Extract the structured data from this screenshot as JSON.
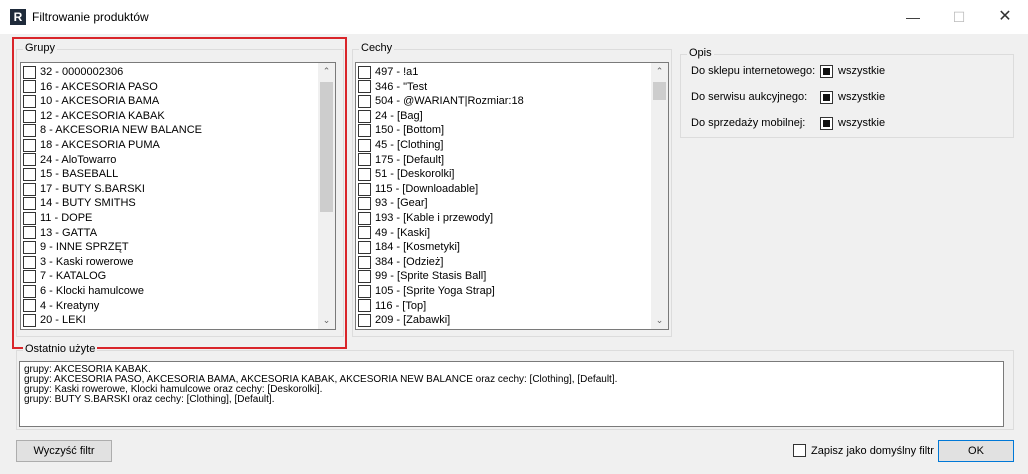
{
  "window": {
    "icon_letter": "R",
    "title": "Filtrowanie produktów",
    "minimize": "—",
    "maximize": "☐",
    "close": "✕"
  },
  "groups": {
    "label": "Grupy",
    "items": [
      "32 - 0000002306",
      "16 - AKCESORIA  PASO",
      "10 - AKCESORIA BAMA",
      "12 - AKCESORIA KABAK",
      "8 - AKCESORIA NEW BALANCE",
      "18 - AKCESORIA PUMA",
      "24 - AloTowarro",
      "15 - BASEBALL",
      "17 - BUTY S.BARSKI",
      "14 - BUTY SMITHS",
      "11 - DOPE",
      "13 - GATTA",
      "9 - INNE SPRZĘT",
      "3 - Kaski rowerowe",
      "7 - KATALOG",
      "6 - Klocki hamulcowe",
      "4 - Kreatyny",
      "20 - LEKI"
    ]
  },
  "features": {
    "label": "Cechy",
    "items": [
      "497 - !a1",
      "346 - \"Test",
      "504 - @WARIANT|Rozmiar:18",
      "24 - [Bag]",
      "150 - [Bottom]",
      "45 - [Clothing]",
      "175 - [Default]",
      "51 - [Deskorolki]",
      "115 - [Downloadable]",
      "93 - [Gear]",
      "193 - [Kable i przewody]",
      "49 - [Kaski]",
      "184 - [Kosmetyki]",
      "384 - [Odzież]",
      "99 - [Sprite Stasis Ball]",
      "105 - [Sprite Yoga Strap]",
      "116 - [Top]",
      "209 - [Zabawki]"
    ]
  },
  "scroll": {
    "up_arrow": "⌃",
    "down_arrow": "⌄"
  },
  "opis": {
    "label": "Opis",
    "rows": [
      {
        "label": "Do sklepu internetowego:",
        "value": "wszystkie",
        "checked": true
      },
      {
        "label": "Do serwisu aukcyjnego:",
        "value": "wszystkie",
        "checked": true
      },
      {
        "label": "Do sprzedaży mobilnej:",
        "value": "wszystkie",
        "checked": true
      }
    ]
  },
  "recent": {
    "label": "Ostatnio użyte",
    "lines": [
      "grupy: AKCESORIA KABAK.",
      "grupy: AKCESORIA  PASO, AKCESORIA BAMA, AKCESORIA KABAK, AKCESORIA NEW BALANCE oraz cechy: [Clothing], [Default].",
      "grupy: Kaski rowerowe, Klocki hamulcowe oraz cechy: [Deskorolki].",
      "grupy: BUTY S.BARSKI oraz cechy: [Clothing], [Default]."
    ]
  },
  "footer": {
    "clear_label": "Wyczyść filtr",
    "save_default_label": "Zapisz jako domyślny filtr",
    "ok_label": "OK"
  },
  "colors": {
    "highlight_border": "#d9252a",
    "accent": "#0078d7"
  }
}
